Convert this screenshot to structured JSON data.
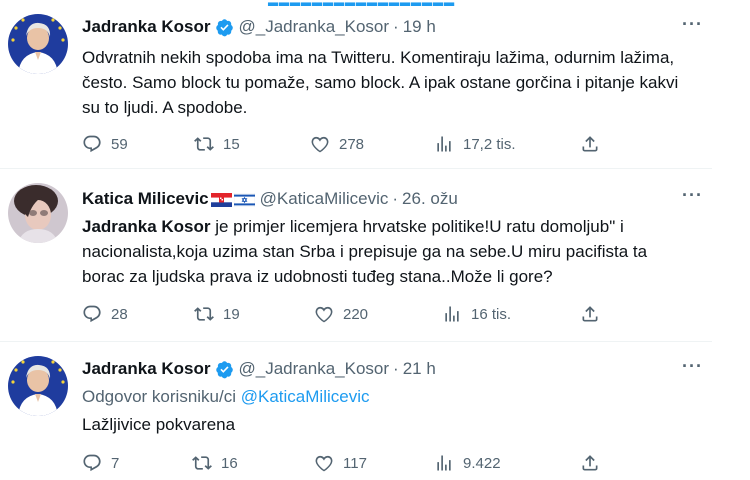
{
  "tweets": [
    {
      "author_name": "Jadranka Kosor",
      "handle": "@_Jadranka_Kosor",
      "time": "19 h",
      "text": "Odvratnih nekih spodoba ima na Twitteru. Komentiraju lažima, odurnim lažima, često. Samo block tu pomaže, samo block. A ipak ostane gorčina i pitanje kakvi su to ljudi. A spodobe.",
      "replies": "59",
      "retweets": "15",
      "likes": "278",
      "views": "17,2 tis."
    },
    {
      "author_name": "Katica Milicevic",
      "handle": "@KaticaMilicevic",
      "time": "26. ožu",
      "mention": "Jadranka Kosor",
      "text": " je primjer licemjera hrvatske politike!U ratu domoljub\" i nacionalista,koja uzima stan Srba i prepisuje ga na sebe.U miru pacifista ta borac za ljudska prava iz udobnosti tuđeg stana..Može li gore?",
      "replies": "28",
      "retweets": "19",
      "likes": "220",
      "views": "16 tis."
    },
    {
      "author_name": "Jadranka Kosor",
      "handle": "@_Jadranka_Kosor",
      "time": "21 h",
      "reply_prefix": "Odgovor korisniku/ci",
      "reply_target": "@KaticaMilicevic",
      "text": "Lažljivice pokvarena",
      "replies": "7",
      "retweets": "16",
      "likes": "117",
      "views": "9.422"
    }
  ],
  "icons": {
    "more": "more-dots-icon",
    "reply": "reply-icon",
    "retweet": "retweet-icon",
    "like": "heart-icon",
    "views": "views-chart-icon",
    "share": "share-icon",
    "verified": "verified-badge-icon"
  },
  "colors": {
    "text": "#0f1419",
    "secondary": "#536471",
    "accent": "#1d9bf0"
  }
}
